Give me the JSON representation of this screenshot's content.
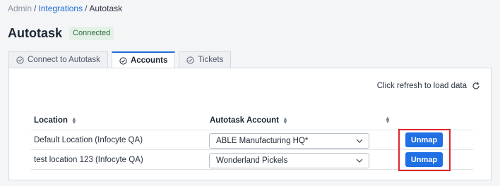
{
  "breadcrumb": {
    "root": "Admin",
    "parent": "Integrations",
    "current": "Autotask"
  },
  "header": {
    "title": "Autotask",
    "status_badge": "Connected"
  },
  "tabs": [
    {
      "label": "Connect to Autotask",
      "active": false
    },
    {
      "label": "Accounts",
      "active": true
    },
    {
      "label": "Tickets",
      "active": false
    }
  ],
  "toolbar": {
    "refresh_label": "Click refresh to load data"
  },
  "table": {
    "columns": [
      "Location",
      "Autotask Account",
      ""
    ],
    "rows": [
      {
        "location": "Default Location (Infocyte QA)",
        "account": "ABLE Manufacturing HQ*",
        "action": "Unmap"
      },
      {
        "location": "test location 123 (Infocyte QA)",
        "account": "Wonderland Pickels",
        "action": "Unmap"
      }
    ]
  },
  "colors": {
    "accent": "#1f6fe5",
    "badge_bg": "#e3f1e6",
    "highlight": "#e0262b"
  }
}
